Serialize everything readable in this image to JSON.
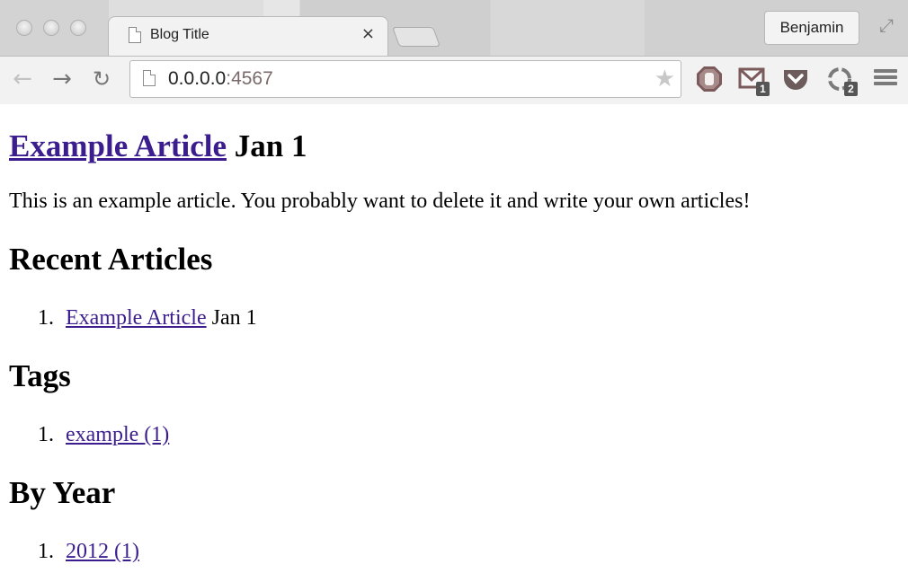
{
  "browser": {
    "tab_title": "Blog Title",
    "tab_close": "×",
    "profile_name": "Benjamin",
    "url_host": "0.0.0.0",
    "url_port": ":4567",
    "extensions": {
      "gmail_badge": "1",
      "sync_badge": "2"
    },
    "icons": {
      "back": "←",
      "forward": "→",
      "reload": "↻",
      "star": "★",
      "fullscreen": "⤢"
    }
  },
  "article": {
    "title": "Example Article",
    "date": "Jan 1",
    "body": "This is an example article. You probably want to delete it and write your own articles!"
  },
  "recent": {
    "heading": "Recent Articles",
    "items": [
      {
        "number": "1.",
        "title": "Example Article",
        "date": "Jan 1"
      }
    ]
  },
  "tags": {
    "heading": "Tags",
    "items": [
      {
        "number": "1.",
        "label": "example (1)"
      }
    ]
  },
  "by_year": {
    "heading": "By Year",
    "items": [
      {
        "number": "1.",
        "label": "2012 (1)"
      }
    ]
  },
  "colors": {
    "link": "#3b1d8e",
    "text": "#000000"
  }
}
